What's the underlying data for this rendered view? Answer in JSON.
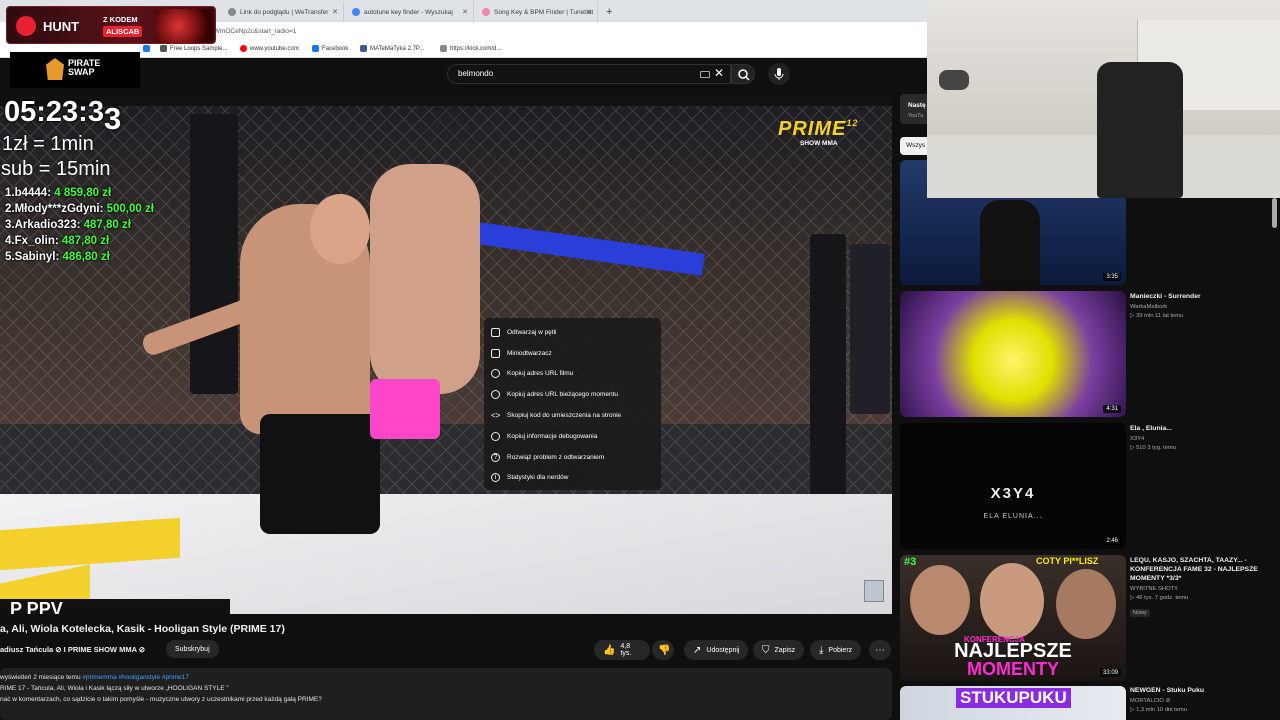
{
  "browser": {
    "tabs": [
      {
        "label": "Link do podglądu | WeTransfer"
      },
      {
        "label": "autotune key finder - Wyszukaj"
      },
      {
        "label": "Song Key & BPM Finder | Tunebat"
      }
    ],
    "url": "/WmOCeNp2c&start_radio=1",
    "bookmarks": [
      "Free Loops Sample...",
      "www.youtube.com",
      "Facebook",
      "MATeMaTyka 2.7P...",
      "https://kick.com/d..."
    ]
  },
  "overlays": {
    "hunt_brand": "HUNT",
    "hunt_promo_1": "Z KODEM",
    "hunt_promo_2": "ALISCAB",
    "pirate_line1": "PIRATE",
    "pirate_line2": "SWAP",
    "timer_main": "05:23:3",
    "timer_sub": "3",
    "rate_1": "1zł = 1min",
    "rate_2": "sub = 15min",
    "leaders": [
      {
        "name": "1.b4444:",
        "amount": "4 859,80 zł"
      },
      {
        "name": "2.Młody***zGdyni:",
        "amount": "500,00 zł"
      },
      {
        "name": "3.Arkadio323:",
        "amount": "487,80 zł"
      },
      {
        "name": "4.Fx_olin:",
        "amount": "487,80 zł"
      },
      {
        "name": "5.Sabinyl:",
        "amount": "486,80 zł"
      }
    ]
  },
  "youtube": {
    "search_value": "belmondo",
    "video_overlay": {
      "logo": "PRIME",
      "logo_num": "12",
      "logo_sub": "SHOW MMA",
      "banner": "P PPV"
    },
    "context_menu": [
      {
        "label": "Odtwarzaj w pętli",
        "icon": "loop-icon"
      },
      {
        "label": "Miniodtwarzacz",
        "icon": "miniplayer-icon"
      },
      {
        "label": "Kopiuj adres URL filmu",
        "icon": "link-icon"
      },
      {
        "label": "Kopiuj adres URL bieżącego momentu",
        "icon": "link-icon"
      },
      {
        "label": "Skopiuj kod do umieszczenia na stronie",
        "icon": "code-icon"
      },
      {
        "label": "Kopiuj informacje debugowania",
        "icon": "debug-icon"
      },
      {
        "label": "Rozwiąż problem z odtwarzaniem",
        "icon": "help-icon"
      },
      {
        "label": "Statystyki dla nerdów",
        "icon": "info-icon"
      }
    ],
    "video_title": "a, Ali, Wiola Kotelecka, Kasik - Hooligan Style (PRIME 17)",
    "channel_line": "adiusz Tańcula ⊘ I PRIME SHOW MMA ⊘",
    "subscribe": "Subskrybuj",
    "likes": "4,8 tys.",
    "share": "Udostępnij",
    "save": "Zapisz",
    "download": "Pobierz",
    "desc_stats": "wyświetleń  2 miesiące temu",
    "desc_tags": "#primemma #hooliganstyle #prime17",
    "desc_line2": "RIME 17 - Tańcula, Ali, Wiola i Kasik łączą siły w utworze „HOOLIGAN STYLE ”",
    "desc_line3": "nać w komentarzach, co sądzicie o takim pomyśle - muzyczne utwory z uczestnikami przed każdą galą PRIME?",
    "next_header_1": "Nastę",
    "next_header_2": "YouTu",
    "chip_all": "Wszys",
    "recommendations": [
      {
        "duration": "3:35"
      },
      {
        "title": "Manieczki - Surrender",
        "channel": "WarkaMalbork",
        "views": "▷ 39 mln  11 lat temu",
        "duration": "4:31"
      },
      {
        "title": "Ela , Elunia...",
        "channel": "X3Y4",
        "views": "▷ 510  3 tyg. temu",
        "duration": "2:46",
        "thumb_text": "X3Y4",
        "thumb_sub": "ELA ELUNIA..."
      },
      {
        "title": "LEQU, KASJO, SZACHTA, TAAZY... - KONFERENCJA FAME 32 - NAJLEPSZE MOMENTY *3/3*",
        "channel": "WYBITNE SHOTY",
        "views": "▷ 46 tys.  7 godz. temu",
        "badge": "Nowy",
        "duration": "33:09",
        "thumb_text": "NAJLEPSZE",
        "thumb_text2": "MOMENTY",
        "thumb_text3": "KONFERENCJA",
        "thumb_text4": "COTY PI**LISZ",
        "thumb_num": "#3"
      },
      {
        "title": "NEWGEN - Stuku Puku",
        "channel": "MORTALCIO ⊘",
        "views": "▷ 1,3 mln  10 dni temu",
        "thumb_text": "STUKUPUKU"
      }
    ]
  }
}
